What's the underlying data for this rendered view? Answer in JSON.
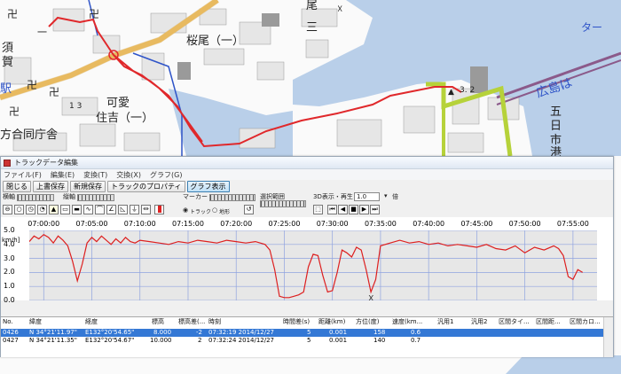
{
  "map": {
    "labels": {
      "sakurao": "桜尾（一）",
      "kaai": "可愛",
      "sumiyoshi": "住吉（一）",
      "sugo": "須",
      "ga": "賀",
      "eki": "駅",
      "gouchousha": "方合同庁舎",
      "three": "三",
      "one": "一",
      "o": "尾",
      "ta": "ター",
      "hiroshima": "広島は",
      "gohi": "五",
      "nichi": "日",
      "shi": "市",
      "kou": "港",
      "mark1": "1 3",
      "mark2": "3. 2"
    },
    "colors": {
      "water": "#b9cfe9",
      "land": "#ffffff",
      "track": "#e0282b",
      "road": "#f5c66a",
      "highlight": "#b6d23a",
      "rail": "#8b5a8a"
    }
  },
  "window": {
    "title": "トラックデータ編集",
    "menu": [
      "ファイル(F)",
      "編集(E)",
      "変換(T)",
      "交換(X)",
      "グラフ(G)"
    ],
    "toolbar1": [
      "閉じる",
      "上書保存",
      "新規保存",
      "トラックのプロパティ",
      "グラフ表示"
    ],
    "toolbar2": {
      "yoko": "横軸",
      "tate": "縦軸",
      "marker": "マーカー",
      "range": "選択範囲",
      "playback": "3D表示・再生",
      "speed": "1.0",
      "bai": "倍",
      "radio_track": "トラック",
      "radio_terrain": "地形"
    }
  },
  "graph": {
    "x_ticks": [
      "07:00:00",
      "07:05:00",
      "07:10:00",
      "07:15:00",
      "07:20:00",
      "07:25:00",
      "07:30:00",
      "07:35:00",
      "07:40:00",
      "07:45:00",
      "07:50:00",
      "07:55:00"
    ],
    "y_ticks": [
      "5.0",
      "4.0",
      "3.0",
      "2.0",
      "1.0",
      "0.0"
    ],
    "y_unit": "km/h]",
    "marker_label": "X"
  },
  "chart_data": {
    "type": "line",
    "ylabel": "km/h]",
    "ylim": [
      0,
      5
    ],
    "x_minutes_after_0700": [
      -1.5,
      -1.0,
      -0.5,
      0,
      0.5,
      1,
      1.5,
      2,
      2.5,
      3,
      3.5,
      4,
      4.5,
      5,
      5.5,
      6,
      6.5,
      7,
      7.5,
      8,
      8.5,
      9,
      9.5,
      10,
      11,
      12,
      13,
      14,
      15,
      16,
      17,
      18,
      19,
      20,
      21,
      22,
      23,
      23.5,
      24,
      24.5,
      25,
      25.5,
      26,
      26.5,
      27,
      27.5,
      28,
      28.5,
      29,
      29.5,
      30,
      30.5,
      31,
      31.5,
      32,
      32.5,
      33,
      33.5,
      34,
      34.5,
      35,
      36,
      37,
      38,
      39,
      40,
      41,
      42,
      43,
      44,
      45,
      46,
      47,
      48,
      49,
      50,
      51,
      52,
      53,
      53.5,
      54,
      54.5,
      55,
      55.5,
      56
    ],
    "values": [
      4.2,
      4.6,
      4.4,
      4.7,
      4.5,
      4.1,
      4.6,
      4.3,
      3.9,
      2.8,
      1.4,
      2.6,
      4.1,
      4.5,
      4.2,
      4.6,
      4.3,
      4.0,
      4.4,
      4.1,
      4.5,
      4.2,
      4.1,
      4.3,
      4.2,
      4.1,
      4.0,
      4.2,
      4.1,
      4.3,
      4.2,
      4.1,
      4.3,
      4.2,
      4.1,
      4.2,
      4.0,
      3.6,
      2.2,
      0.3,
      0.2,
      0.2,
      0.3,
      0.4,
      0.6,
      2.4,
      3.3,
      3.2,
      1.8,
      0.6,
      0.7,
      2.0,
      3.6,
      3.4,
      3.1,
      3.8,
      3.6,
      2.2,
      0.6,
      1.5,
      3.9,
      4.1,
      4.3,
      4.1,
      4.2,
      4.0,
      4.1,
      3.9,
      4.0,
      3.9,
      3.8,
      4.0,
      3.7,
      3.6,
      3.9,
      3.4,
      3.8,
      3.6,
      3.9,
      3.7,
      3.2,
      1.7,
      1.5,
      2.2,
      2.0,
      2.3
    ],
    "marker_x": 34
  },
  "table": {
    "headers": [
      "No.",
      "緯度",
      "経度",
      "標高",
      "標高差(...",
      "時刻",
      "時間差(s)",
      "距離(km)",
      "方位(度)",
      "速度(km...",
      "汎用1",
      "汎用2",
      "区間タイ...",
      "区間距...",
      "区間カロ..."
    ],
    "rows": [
      [
        "0426",
        "N 34°21'11.97\"",
        "E132°20'54.65\"",
        "8.000",
        "-2",
        "07:32:19 2014/12/27",
        "5",
        "0.001",
        "158",
        "0.6"
      ],
      [
        "0427",
        "N 34°21'11.35\"",
        "E132°20'54.67\"",
        "10.000",
        "2",
        "07:32:24 2014/12/27",
        "5",
        "0.001",
        "140",
        "0.7"
      ]
    ]
  }
}
